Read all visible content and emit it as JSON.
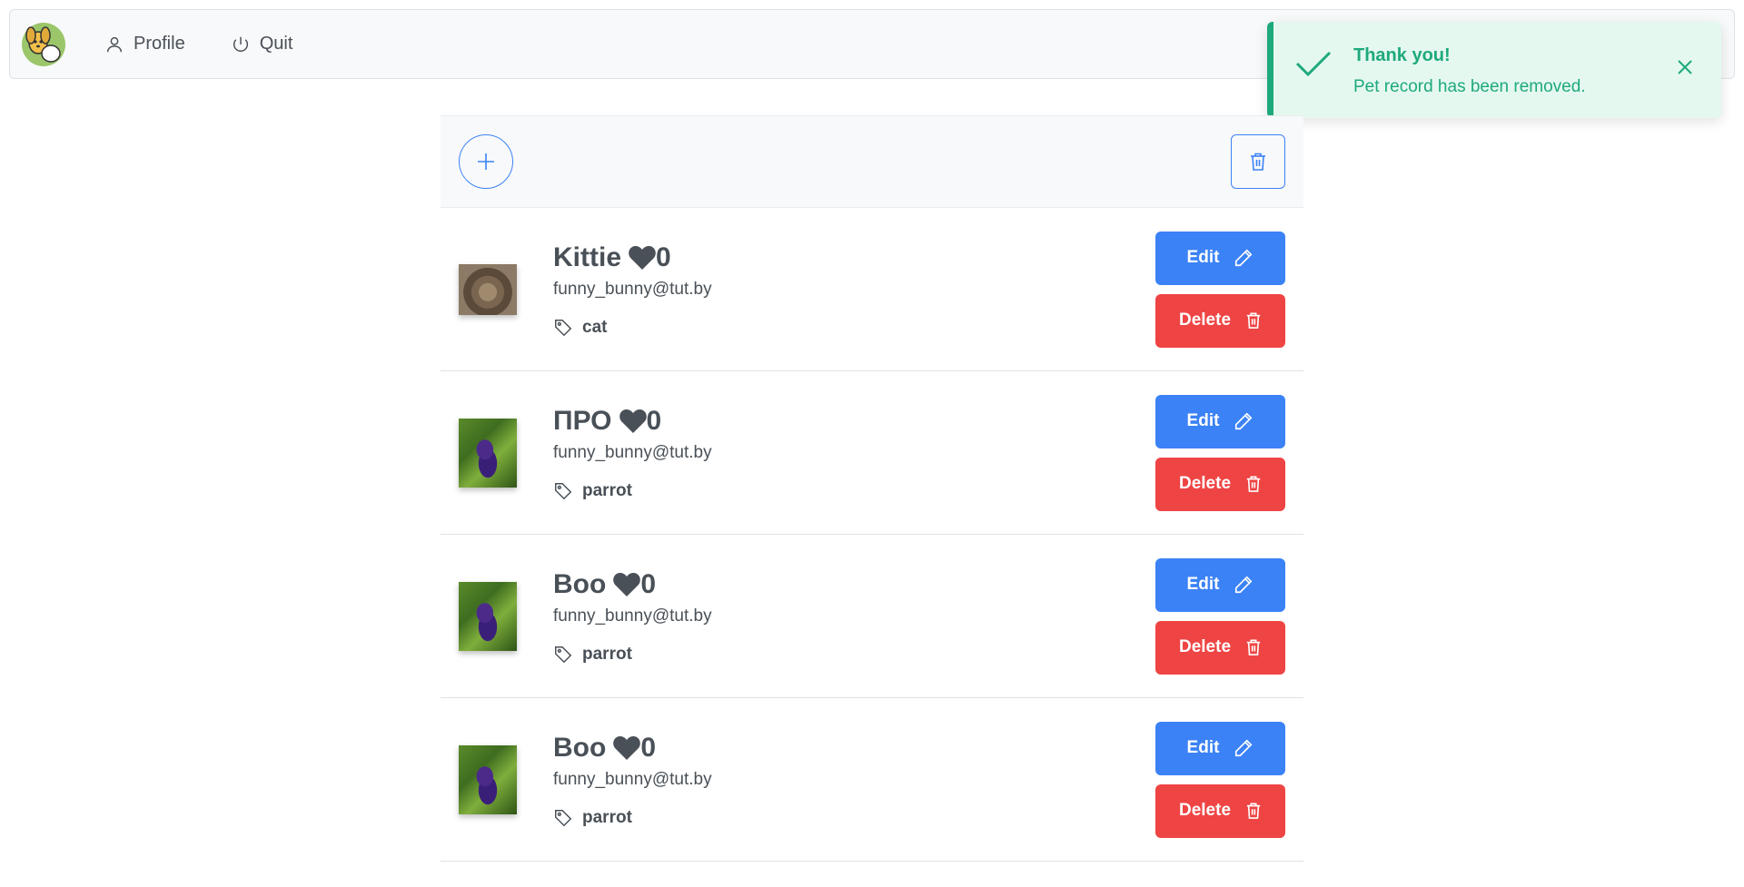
{
  "navbar": {
    "logo_icon": "pets-logo-icon",
    "items": [
      {
        "label": "Profile",
        "icon": "user-icon"
      },
      {
        "label": "Quit",
        "icon": "power-icon"
      }
    ]
  },
  "toast": {
    "summary": "Thank you!",
    "detail": "Pet record has been removed.",
    "icon": "check-icon",
    "close_icon": "close-icon",
    "color": "#1ea97c"
  },
  "toolbar": {
    "add_icon": "plus-icon",
    "delete_selected_icon": "trash-icon"
  },
  "pets": [
    {
      "name": "Kittie",
      "likes": "0",
      "owner": "funny_bunny@tut.by",
      "tag": "cat",
      "image": "cat"
    },
    {
      "name": "ПРО",
      "likes": "0",
      "owner": "funny_bunny@tut.by",
      "tag": "parrot",
      "image": "parrot"
    },
    {
      "name": "Boo",
      "likes": "0",
      "owner": "funny_bunny@tut.by",
      "tag": "parrot",
      "image": "parrot"
    },
    {
      "name": "Boo",
      "likes": "0",
      "owner": "funny_bunny@tut.by",
      "tag": "parrot",
      "image": "parrot"
    }
  ],
  "buttons": {
    "edit_label": "Edit",
    "delete_label": "Delete"
  },
  "colors": {
    "primary": "#3b82f6",
    "danger": "#ef4444",
    "success": "#1ea97c"
  }
}
